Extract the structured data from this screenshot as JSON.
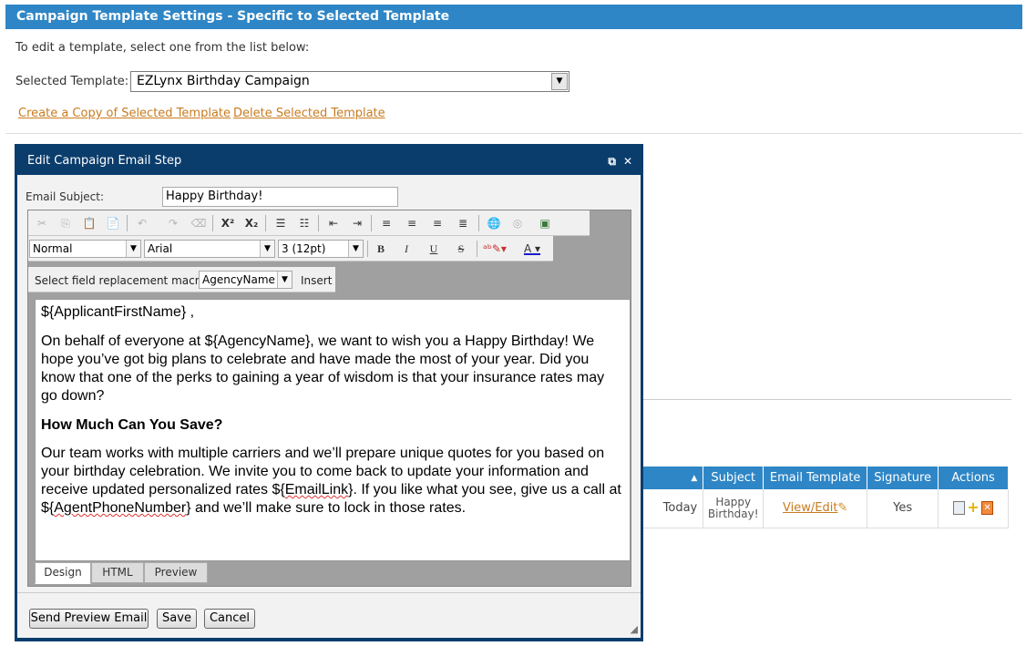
{
  "header": {
    "title": "Campaign Template Settings - Specific to Selected Template"
  },
  "intro": "To edit a template, select one from the list below:",
  "template": {
    "label": "Selected Template:",
    "selected": "EZLynx Birthday Campaign",
    "copy_link": "Create a Copy of Selected Template",
    "delete_link": "Delete Selected Template"
  },
  "table": {
    "headers": [
      "▲",
      "Subject",
      "Email Template",
      "Signature",
      "Actions"
    ],
    "row": {
      "date": "Today",
      "subject_line1": "Happy",
      "subject_line2": "Birthday!",
      "template_link": "View/Edit",
      "signature": "Yes"
    }
  },
  "modal": {
    "title": "Edit Campaign Email Step",
    "subject_label": "Email Subject:",
    "subject_value": "Happy Birthday!",
    "format_value": "Normal",
    "font_value": "Arial",
    "size_value": "3 (12pt)",
    "macro_label": "Select field replacement macro:",
    "macro_value": "AgencyName",
    "macro_insert": "Insert",
    "content": {
      "greeting": "${ApplicantFirstName} ,",
      "para1": "On behalf of everyone at ${AgencyName}, we want to wish you a Happy Birthday!  We hope you’ve got big plans to celebrate and have made the most of your year.  Did you know that one of the perks to gaining a year of wisdom is that your insurance rates may go down?",
      "heading": "How Much Can You Save?",
      "para2_a": "Our team works with multiple carriers and we’ll prepare unique quotes for you based on your birthday celebration.  We invite you to come back to update your information and receive updated personalized rates ${",
      "para2_link1": "EmailLink",
      "para2_b": "}.   If you like what you see, give us a call at ${",
      "para2_link2": "AgentPhoneNumber",
      "para2_c": "} and we’ll make sure to lock in those rates."
    },
    "tabs": [
      "Design",
      "HTML",
      "Preview"
    ],
    "buttons": {
      "send_preview": "Send Preview Email",
      "save": "Save",
      "cancel": "Cancel"
    }
  },
  "colors": {
    "header_blue": "#2f86c6",
    "modal_navy": "#0b3d6c",
    "link_orange": "#c97b1f"
  }
}
